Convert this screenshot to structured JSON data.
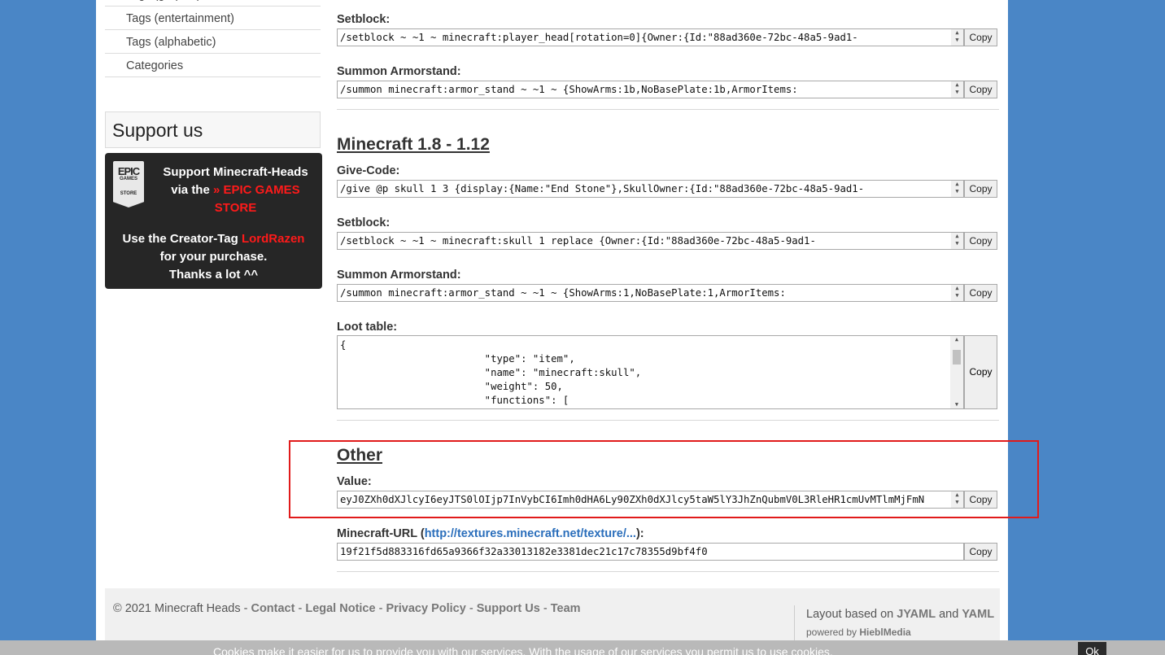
{
  "sidebar": {
    "partial_item": "Tags (graphic)",
    "items": [
      "Tags (entertainment)",
      "Tags (alphabetic)",
      "Categories"
    ]
  },
  "support": {
    "heading": "Support us",
    "logo_top": "EPIC",
    "logo_mid": "GAMES",
    "logo_bottom": "STORE",
    "line1": "Support Minecraft-Heads",
    "line2a": "via the ",
    "store_link": "» EPIC GAMES STORE",
    "line3a": "Use the Creator-Tag ",
    "creator_tag": "LordRazen",
    "line3b": "for your purchase.",
    "line4": "Thanks a lot ^^"
  },
  "top_block": {
    "setblock_label": "Setblock:",
    "setblock_value": "/setblock ~ ~1 ~ minecraft:player_head[rotation=0]{Owner:{Id:\"88ad360e-72bc-48a5-9ad1-",
    "armorstand_label": "Summon Armorstand:",
    "armorstand_value": "/summon minecraft:armor_stand ~ ~1 ~ {ShowArms:1b,NoBasePlate:1b,ArmorItems:"
  },
  "legacy": {
    "title": "Minecraft 1.8 - 1.12",
    "give_label": "Give-Code:",
    "give_value": "/give @p skull 1 3 {display:{Name:\"End Stone\"},SkullOwner:{Id:\"88ad360e-72bc-48a5-9ad1-",
    "setblock_label": "Setblock:",
    "setblock_value": "/setblock ~ ~1 ~ minecraft:skull 1 replace {Owner:{Id:\"88ad360e-72bc-48a5-9ad1-",
    "armorstand_label": "Summon Armorstand:",
    "armorstand_value": "/summon minecraft:armor_stand ~ ~1 ~ {ShowArms:1,NoBasePlate:1,ArmorItems:",
    "loot_label": "Loot table:",
    "loot_value": "{\n                        \"type\": \"item\",\n                        \"name\": \"minecraft:skull\",\n                        \"weight\": 50,\n                        \"functions\": ["
  },
  "other": {
    "title": "Other",
    "value_label": "Value:",
    "value_value": "eyJ0ZXh0dXJlcyI6eyJTS0lOIjp7InVybCI6Imh0dHA6Ly90ZXh0dXJlcy5taW5lY3JhZnQubmV0L3RleHR1cmUvMTlmMjFmN",
    "url_label_prefix": "Minecraft-URL (",
    "url_link": "http://textures.minecraft.net/texture/...",
    "url_label_suffix": "):",
    "url_value": "19f21f5d883316fd65a9366f32a33013182e3381dec21c17c78355d9bf4f0"
  },
  "copy_label": "Copy",
  "footer": {
    "copyright": "© 2021 Minecraft Heads - ",
    "links": [
      "Contact",
      "Legal Notice",
      "Privacy Policy",
      "Support Us",
      "Team"
    ],
    "sep": " - ",
    "layout_prefix": "Layout based on ",
    "layout_link1": "JYAML",
    "layout_and": " and ",
    "layout_link2": "YAML",
    "powered_prefix": "powered by ",
    "powered_link": "HieblMedia"
  },
  "cookie": {
    "text": "Cookies make it easier for us to provide you with our services. With the usage of our services you permit us to use cookies.",
    "ok": "Ok"
  }
}
